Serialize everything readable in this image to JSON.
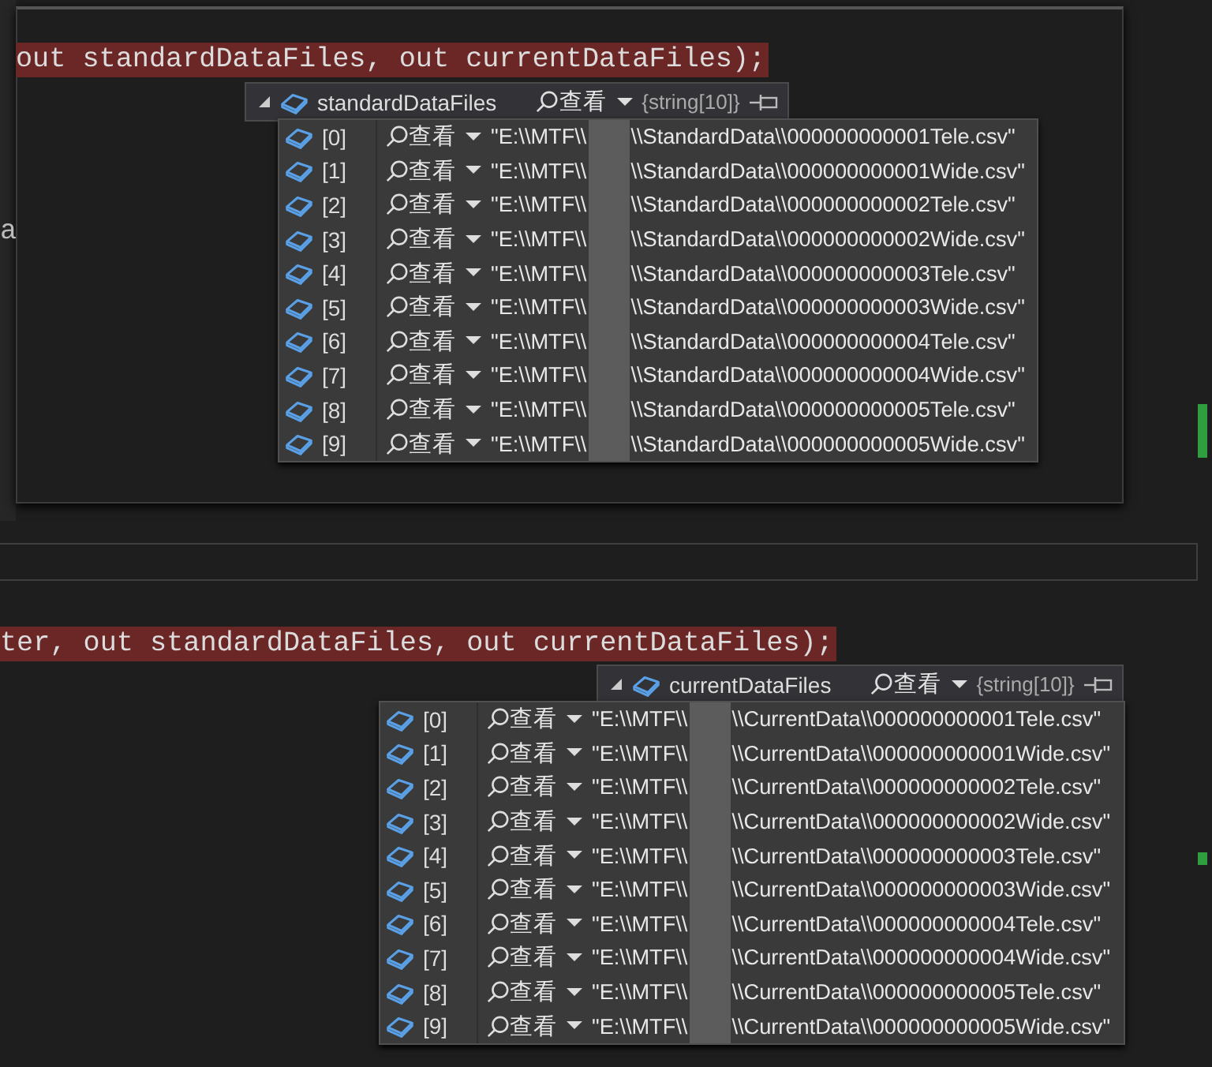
{
  "top_pane": {
    "code_line": "out standardDataFiles, out currentDataFiles);",
    "side_fragment": "a",
    "datatip": {
      "expanded": true,
      "name": "standardDataFiles",
      "visualizer": "查看",
      "type": "{string[10]}",
      "items": [
        {
          "index": "[0]",
          "visualizer": "查看",
          "value_start": "\"E:\\\\MTF\\\\",
          "value_end": "\\\\StandardData\\\\000000000001Tele.csv\""
        },
        {
          "index": "[1]",
          "visualizer": "查看",
          "value_start": "\"E:\\\\MTF\\\\",
          "value_end": "\\\\StandardData\\\\000000000001Wide.csv\""
        },
        {
          "index": "[2]",
          "visualizer": "查看",
          "value_start": "\"E:\\\\MTF\\\\",
          "value_end": "\\\\StandardData\\\\000000000002Tele.csv\""
        },
        {
          "index": "[3]",
          "visualizer": "查看",
          "value_start": "\"E:\\\\MTF\\\\",
          "value_end": "\\\\StandardData\\\\000000000002Wide.csv\""
        },
        {
          "index": "[4]",
          "visualizer": "查看",
          "value_start": "\"E:\\\\MTF\\\\",
          "value_end": "\\\\StandardData\\\\000000000003Tele.csv\""
        },
        {
          "index": "[5]",
          "visualizer": "查看",
          "value_start": "\"E:\\\\MTF\\\\",
          "value_end": "\\\\StandardData\\\\000000000003Wide.csv\""
        },
        {
          "index": "[6]",
          "visualizer": "查看",
          "value_start": "\"E:\\\\MTF\\\\",
          "value_end": "\\\\StandardData\\\\000000000004Tele.csv\""
        },
        {
          "index": "[7]",
          "visualizer": "查看",
          "value_start": "\"E:\\\\MTF\\\\",
          "value_end": "\\\\StandardData\\\\000000000004Wide.csv\""
        },
        {
          "index": "[8]",
          "visualizer": "查看",
          "value_start": "\"E:\\\\MTF\\\\",
          "value_end": "\\\\StandardData\\\\000000000005Tele.csv\""
        },
        {
          "index": "[9]",
          "visualizer": "查看",
          "value_start": "\"E:\\\\MTF\\\\",
          "value_end": "\\\\StandardData\\\\000000000005Wide.csv\""
        }
      ]
    }
  },
  "bottom_pane": {
    "code_line": "ter, out standardDataFiles, out currentDataFiles);",
    "datatip": {
      "expanded": true,
      "name": "currentDataFiles",
      "visualizer": "查看",
      "type": "{string[10]}",
      "items": [
        {
          "index": "[0]",
          "visualizer": "查看",
          "value_start": "\"E:\\\\MTF\\\\",
          "value_end": "\\\\CurrentData\\\\000000000001Tele.csv\""
        },
        {
          "index": "[1]",
          "visualizer": "查看",
          "value_start": "\"E:\\\\MTF\\\\",
          "value_end": "\\\\CurrentData\\\\000000000001Wide.csv\""
        },
        {
          "index": "[2]",
          "visualizer": "查看",
          "value_start": "\"E:\\\\MTF\\\\",
          "value_end": "\\\\CurrentData\\\\000000000002Tele.csv\""
        },
        {
          "index": "[3]",
          "visualizer": "查看",
          "value_start": "\"E:\\\\MTF\\\\",
          "value_end": "\\\\CurrentData\\\\000000000002Wide.csv\""
        },
        {
          "index": "[4]",
          "visualizer": "查看",
          "value_start": "\"E:\\\\MTF\\\\",
          "value_end": "\\\\CurrentData\\\\000000000003Tele.csv\""
        },
        {
          "index": "[5]",
          "visualizer": "查看",
          "value_start": "\"E:\\\\MTF\\\\",
          "value_end": "\\\\CurrentData\\\\000000000003Wide.csv\""
        },
        {
          "index": "[6]",
          "visualizer": "查看",
          "value_start": "\"E:\\\\MTF\\\\",
          "value_end": "\\\\CurrentData\\\\000000000004Tele.csv\""
        },
        {
          "index": "[7]",
          "visualizer": "查看",
          "value_start": "\"E:\\\\MTF\\\\",
          "value_end": "\\\\CurrentData\\\\000000000004Wide.csv\""
        },
        {
          "index": "[8]",
          "visualizer": "查看",
          "value_start": "\"E:\\\\MTF\\\\",
          "value_end": "\\\\CurrentData\\\\000000000005Tele.csv\""
        },
        {
          "index": "[9]",
          "visualizer": "查看",
          "value_start": "\"E:\\\\MTF\\\\",
          "value_end": "\\\\CurrentData\\\\000000000005Wide.csv\""
        }
      ]
    }
  }
}
